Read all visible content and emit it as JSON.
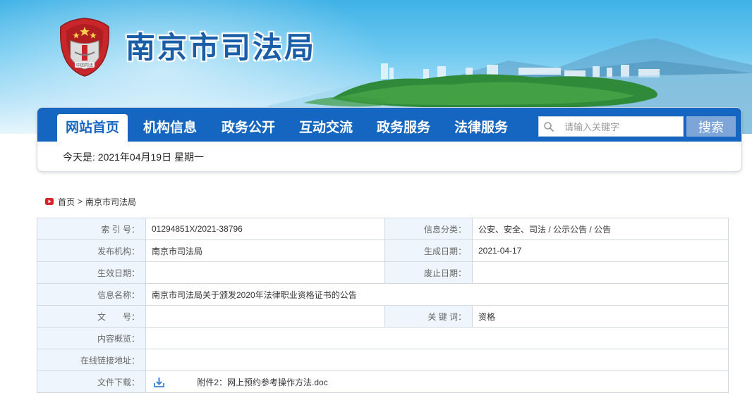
{
  "header": {
    "site_title": "南京市司法局",
    "emblem_text": "中国司法"
  },
  "nav": {
    "items": [
      {
        "label": "网站首页",
        "active": true
      },
      {
        "label": "机构信息",
        "active": false
      },
      {
        "label": "政务公开",
        "active": false
      },
      {
        "label": "互动交流",
        "active": false
      },
      {
        "label": "政务服务",
        "active": false
      },
      {
        "label": "法律服务",
        "active": false
      }
    ],
    "search_placeholder": "请输入关键字",
    "search_button": "搜索",
    "today": "今天是: 2021年04月19日 星期一"
  },
  "breadcrumb": {
    "home": "首页",
    "separator": ">",
    "current": "南京市司法局"
  },
  "info": {
    "index_label": "索 引 号：",
    "index_value": "01294851X/2021-38796",
    "category_label": "信息分类：",
    "category_value": "公安、安全、司法 / 公示公告 / 公告",
    "publisher_label": "发布机构：",
    "publisher_value": "南京市司法局",
    "generated_label": "生成日期：",
    "generated_value": "2021-04-17",
    "effective_label": "生效日期：",
    "effective_value": "",
    "expiry_label": "废止日期：",
    "expiry_value": "",
    "name_label": "信息名称：",
    "name_value": "南京市司法局关于颁发2020年法律职业资格证书的公告",
    "docno_label": "文　　号：",
    "docno_value": "",
    "keywords_label": "关 键 词：",
    "keywords_value": "资格",
    "summary_label": "内容概览：",
    "summary_value": "",
    "link_label": "在线链接地址：",
    "link_value": "",
    "download_label": "文件下载：",
    "download_file": "附件2：网上预约参考操作方法.doc"
  },
  "colors": {
    "nav_blue": "#1566c0",
    "title_blue": "#1b5ea8",
    "label_bg": "#eef5fc",
    "search_button_bg": "#7ea5d8",
    "emblem_red": "#c8262a"
  },
  "icons": {
    "search": "search-icon",
    "breadcrumb_home": "play-icon",
    "download": "download-icon"
  }
}
